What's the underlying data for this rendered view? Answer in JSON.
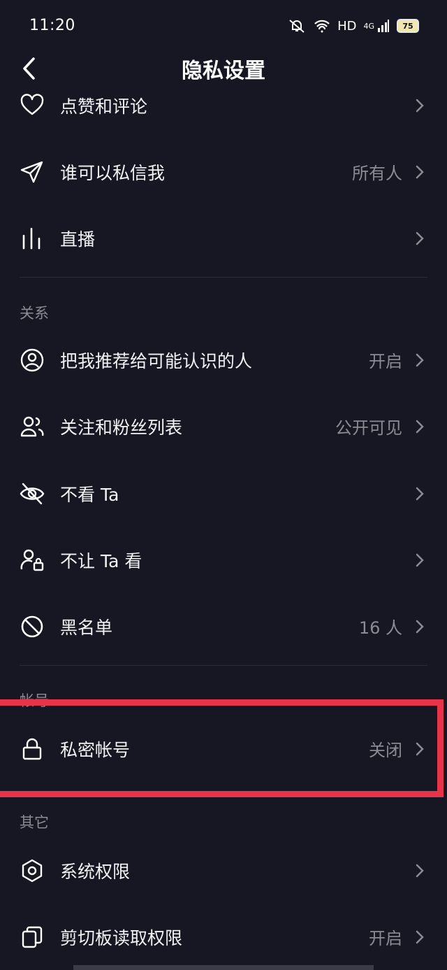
{
  "status_bar": {
    "time": "11:20",
    "network": "HD",
    "signal": "4G",
    "battery": "75"
  },
  "header": {
    "title": "隐私设置"
  },
  "items": [
    {
      "label": "点赞和评论",
      "value": ""
    },
    {
      "label": "谁可以私信我",
      "value": "所有人"
    },
    {
      "label": "直播",
      "value": ""
    }
  ],
  "relation": {
    "section_title": "关系",
    "items": [
      {
        "label": "把我推荐给可能认识的人",
        "value": "开启"
      },
      {
        "label": "关注和粉丝列表",
        "value": "公开可见"
      },
      {
        "label": "不看 Ta",
        "value": ""
      },
      {
        "label": "不让 Ta 看",
        "value": ""
      },
      {
        "label": "黑名单",
        "value": "16 人"
      }
    ]
  },
  "account": {
    "section_title": "帐号",
    "items": [
      {
        "label": "私密帐号",
        "value": "关闭"
      }
    ]
  },
  "other": {
    "section_title": "其它",
    "items": [
      {
        "label": "系统权限",
        "value": ""
      },
      {
        "label": "剪切板读取权限",
        "value": "开启"
      }
    ]
  },
  "colors": {
    "background": "#161722",
    "highlight": "#e8344a",
    "secondary_text": "#8a8b93"
  }
}
